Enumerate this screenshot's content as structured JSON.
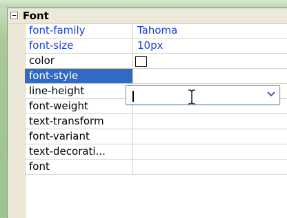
{
  "category": {
    "label": "Font",
    "toggle": "−"
  },
  "rows": [
    {
      "name": "font-family",
      "value": "Tahoma"
    },
    {
      "name": "font-size",
      "value": "10px"
    },
    {
      "name": "color",
      "value": ""
    },
    {
      "name": "font-style",
      "value": ""
    },
    {
      "name": "line-height",
      "value": ""
    },
    {
      "name": "font-weight",
      "value": ""
    },
    {
      "name": "text-transform",
      "value": ""
    },
    {
      "name": "font-variant",
      "value": ""
    },
    {
      "name": "text-decorati...",
      "value": ""
    },
    {
      "name": "font",
      "value": ""
    }
  ],
  "editor": {
    "value": "",
    "dropdown_icon": "chevron-down-icon"
  },
  "colors": {
    "selection": "#316ac5",
    "set_value": "#1a3fd6",
    "grid_line": "#d4d0c8"
  }
}
